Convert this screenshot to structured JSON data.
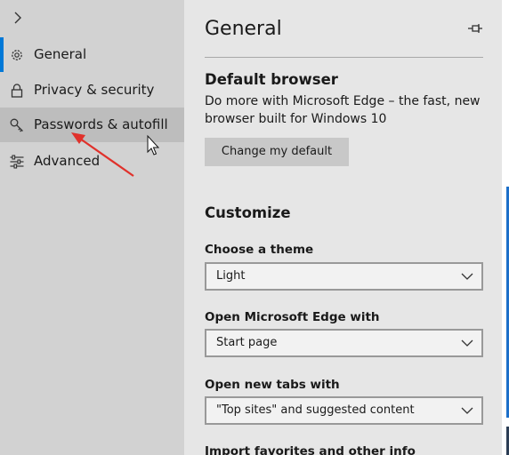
{
  "sidebar": {
    "items": [
      {
        "label": "General",
        "icon": "gear-icon"
      },
      {
        "label": "Privacy & security",
        "icon": "lock-icon"
      },
      {
        "label": "Passwords & autofill",
        "icon": "key-icon"
      },
      {
        "label": "Advanced",
        "icon": "sliders-icon"
      }
    ]
  },
  "main": {
    "title": "General",
    "default_browser": {
      "heading": "Default browser",
      "description": "Do more with Microsoft Edge – the fast, new browser built for Windows 10",
      "button_label": "Change my default"
    },
    "customize": {
      "heading": "Customize",
      "theme": {
        "label": "Choose a theme",
        "value": "Light"
      },
      "open_with": {
        "label": "Open Microsoft Edge with",
        "value": "Start page"
      },
      "new_tabs": {
        "label": "Open new tabs with",
        "value": "\"Top sites\" and suggested content"
      }
    },
    "import_heading": "Import favorites and other info"
  },
  "colors": {
    "accent": "#0078d7",
    "annotation_arrow": "#e0312b"
  }
}
